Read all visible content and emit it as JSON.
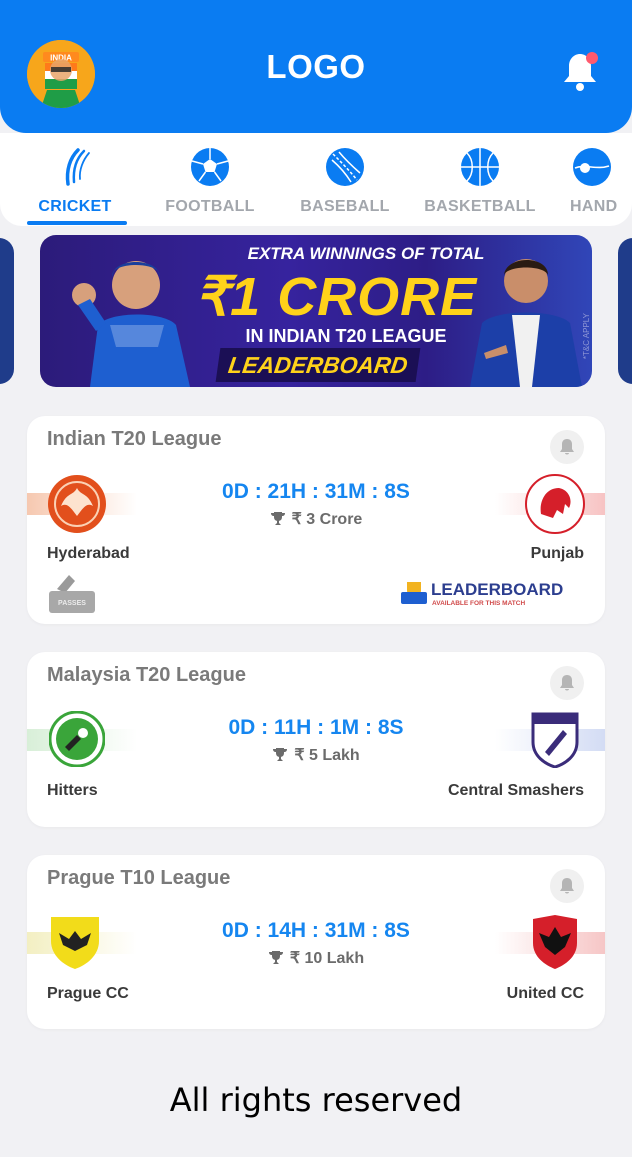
{
  "header": {
    "logo_text": "LOGO",
    "avatar_text": "INDIA",
    "accent_color": "#0a7cf2",
    "notification_dot_color": "#ff5a6e"
  },
  "sport_tabs": [
    {
      "label": "CRICKET",
      "icon": "cricket-icon",
      "active": true
    },
    {
      "label": "FOOTBALL",
      "icon": "football-icon",
      "active": false
    },
    {
      "label": "BASEBALL",
      "icon": "baseball-icon",
      "active": false
    },
    {
      "label": "BASKETBALL",
      "icon": "basketball-icon",
      "active": false
    },
    {
      "label": "HAND",
      "icon": "handball-icon",
      "active": false
    }
  ],
  "banner": {
    "line1": "EXTRA WINNINGS OF TOTAL",
    "line2": "₹1 CRORE",
    "line3": "IN INDIAN T20 LEAGUE",
    "line4": "LEADERBOARD",
    "disclaimer": "*T&C APPLY"
  },
  "matches": [
    {
      "league": "Indian T20 League",
      "timer": "0D : 21H : 31M : 8S",
      "prize": "₹ 3 Crore",
      "team1": "Hyderabad",
      "team2": "Punjab",
      "passes_label": "PASSES",
      "leaderboard_title": "LEADERBOARD",
      "leaderboard_sub": "AVAILABLE FOR THIS MATCH"
    },
    {
      "league": "Malaysia T20 League",
      "timer": "0D : 11H : 1M : 8S",
      "prize": "₹ 5 Lakh",
      "team1": "Hitters",
      "team2": "Central Smashers"
    },
    {
      "league": "Prague T10 League",
      "timer": "0D : 14H : 31M : 8S",
      "prize": "₹ 10 Lakh",
      "team1": "Prague CC",
      "team2": "United CC"
    }
  ],
  "footer": {
    "text": "All rights reserved"
  }
}
